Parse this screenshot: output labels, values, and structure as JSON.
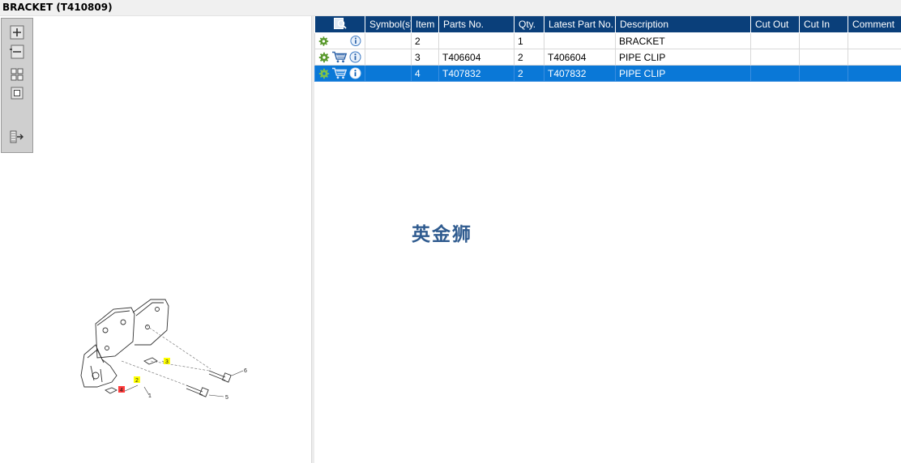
{
  "window": {
    "title": "BRACKET (T410809)"
  },
  "toolbar": {
    "buttons": [
      {
        "name": "zoom-in",
        "icon": "plus-magnifier-icon"
      },
      {
        "name": "zoom-out",
        "icon": "minus-magnifier-icon"
      },
      {
        "name": "fit-all",
        "icon": "fit-grid-icon"
      },
      {
        "name": "actual-size",
        "icon": "square-frame-icon"
      },
      {
        "name": "toggle-list",
        "icon": "list-arrow-icon"
      }
    ]
  },
  "drawing": {
    "callouts": [
      {
        "label": "1"
      },
      {
        "label": "2"
      },
      {
        "label": "3"
      },
      {
        "label": "4"
      },
      {
        "label": "5"
      },
      {
        "label": "6"
      }
    ],
    "highlight_color": "#ffff00",
    "selected_color": "#ff0000"
  },
  "table": {
    "columns": [
      "",
      "Symbol(s)",
      "Item",
      "Parts No.",
      "Qty.",
      "Latest Part No.",
      "Description",
      "Cut Out",
      "Cut In",
      "Comment"
    ],
    "rows": [
      {
        "icons": [
          "gear-icon",
          "info-icon"
        ],
        "symbol": "",
        "item": "2",
        "part_no": "",
        "qty": "1",
        "latest": "",
        "desc": "BRACKET",
        "cut_out": "",
        "cut_in": "",
        "comment": ""
      },
      {
        "icons": [
          "gear-icon",
          "cart-icon",
          "info-icon"
        ],
        "symbol": "",
        "item": "3",
        "part_no": "T406604",
        "qty": "2",
        "latest": "T406604",
        "desc": "PIPE CLIP",
        "cut_out": "",
        "cut_in": "",
        "comment": ""
      },
      {
        "icons": [
          "gear-icon",
          "cart-icon",
          "info-icon"
        ],
        "symbol": "",
        "item": "4",
        "part_no": "T407832",
        "qty": "2",
        "latest": "T407832",
        "desc": "PIPE CLIP",
        "cut_out": "",
        "cut_in": "",
        "comment": "",
        "selected": true
      }
    ],
    "header_color": "#0a3f7a",
    "selected_row_color": "#0a78d7"
  },
  "watermark": {
    "text": "英金狮"
  }
}
